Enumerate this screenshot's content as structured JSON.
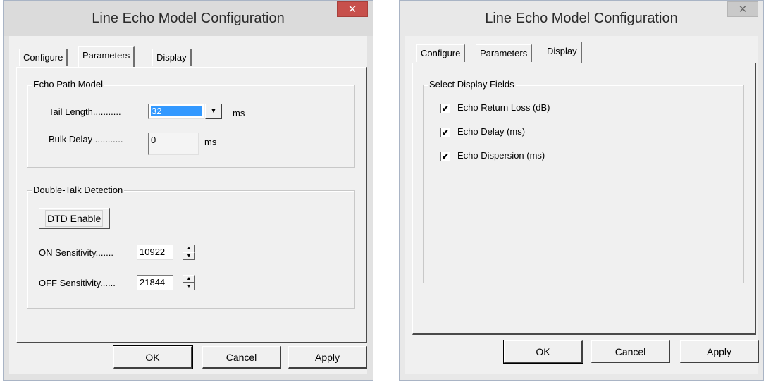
{
  "left_dialog": {
    "title": "Line Echo Model Configuration",
    "close_glyph": "✕",
    "tabs": [
      {
        "label": "Configure",
        "active": false
      },
      {
        "label": "Parameters",
        "active": true
      },
      {
        "label": "Display",
        "active": false
      }
    ],
    "echo_path": {
      "group_label": "Echo Path Model",
      "tail_length_label": "Tail Length...........",
      "tail_length_value": "32",
      "tail_length_unit": "ms",
      "bulk_delay_label": "Bulk Delay ...........",
      "bulk_delay_value": "0",
      "bulk_delay_unit": "ms"
    },
    "double_talk": {
      "group_label": "Double-Talk Detection",
      "dtd_button": "DTD Enable",
      "on_label": "ON Sensitivity.......",
      "on_value": "10922",
      "off_label": "OFF Sensitivity......",
      "off_value": "21844"
    },
    "buttons": {
      "ok": "OK",
      "cancel": "Cancel",
      "apply": "Apply"
    }
  },
  "right_dialog": {
    "title": "Line Echo Model Configuration",
    "close_glyph": "✕",
    "tabs": [
      {
        "label": "Configure",
        "active": false
      },
      {
        "label": "Parameters",
        "active": false
      },
      {
        "label": "Display",
        "active": true
      }
    ],
    "display_fields": {
      "group_label": "Select Display Fields",
      "items": [
        {
          "label": "Echo Return Loss (dB)",
          "checked": true
        },
        {
          "label": "Echo Delay (ms)",
          "checked": true
        },
        {
          "label": "Echo Dispersion (ms)",
          "checked": true
        }
      ]
    },
    "check_glyph": "✔",
    "buttons": {
      "ok": "OK",
      "cancel": "Cancel",
      "apply": "Apply"
    }
  },
  "icons": {
    "dropdown": "▼",
    "spin_up": "▲",
    "spin_down": "▼"
  },
  "colors": {
    "close_active": "#c7504c",
    "selection": "#3399ff"
  }
}
